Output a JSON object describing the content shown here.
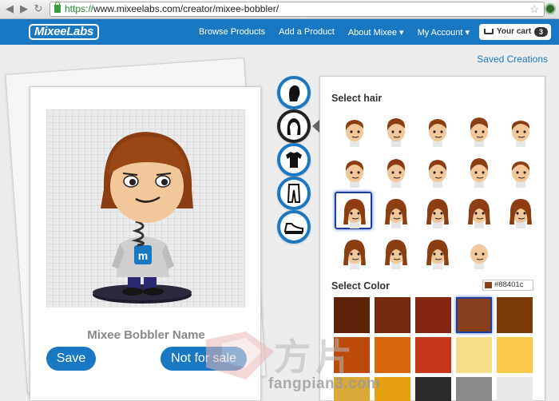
{
  "browser": {
    "url_scheme": "https://",
    "url_rest": "www.mixeelabs.com/creator/mixee-bobbler/",
    "back_icon": "arrow-left-icon",
    "forward_icon": "arrow-right-icon",
    "reload_icon": "reload-icon"
  },
  "header": {
    "logo": "MixeeLabs",
    "nav": [
      "Browse Products",
      "Add a Product",
      "About Mixee ▾",
      "My Account ▾"
    ],
    "cart_label": "Your cart",
    "cart_count": "3",
    "brand_color": "#1a78c2"
  },
  "saved_creations": "Saved Creations",
  "preview": {
    "name": "Mixee Bobbler Name",
    "save_label": "Save",
    "sale_label": "Not for sale"
  },
  "categories": [
    {
      "icon": "head-icon",
      "active": false
    },
    {
      "icon": "hair-icon",
      "active": true
    },
    {
      "icon": "shirt-icon",
      "active": false
    },
    {
      "icon": "pants-icon",
      "active": false
    },
    {
      "icon": "shoe-icon",
      "active": false
    }
  ],
  "hair_panel": {
    "title": "Select hair",
    "selected_index": 10,
    "count": 19
  },
  "color_panel": {
    "title": "Select Color",
    "hex_value": "#88401c",
    "colors": [
      "#5e2208",
      "#76280d",
      "#842611",
      "#88401c",
      "#7a3a08",
      "#bc4a0a",
      "#d96608",
      "#c8361a",
      "#f5e08a",
      "#fbca4a",
      "#d8a838",
      "#e6a010",
      "#2a2a2a",
      "#8a8a8a",
      "#e8e8e8"
    ],
    "selected_index": 3
  },
  "watermark": "fangpian3.com"
}
